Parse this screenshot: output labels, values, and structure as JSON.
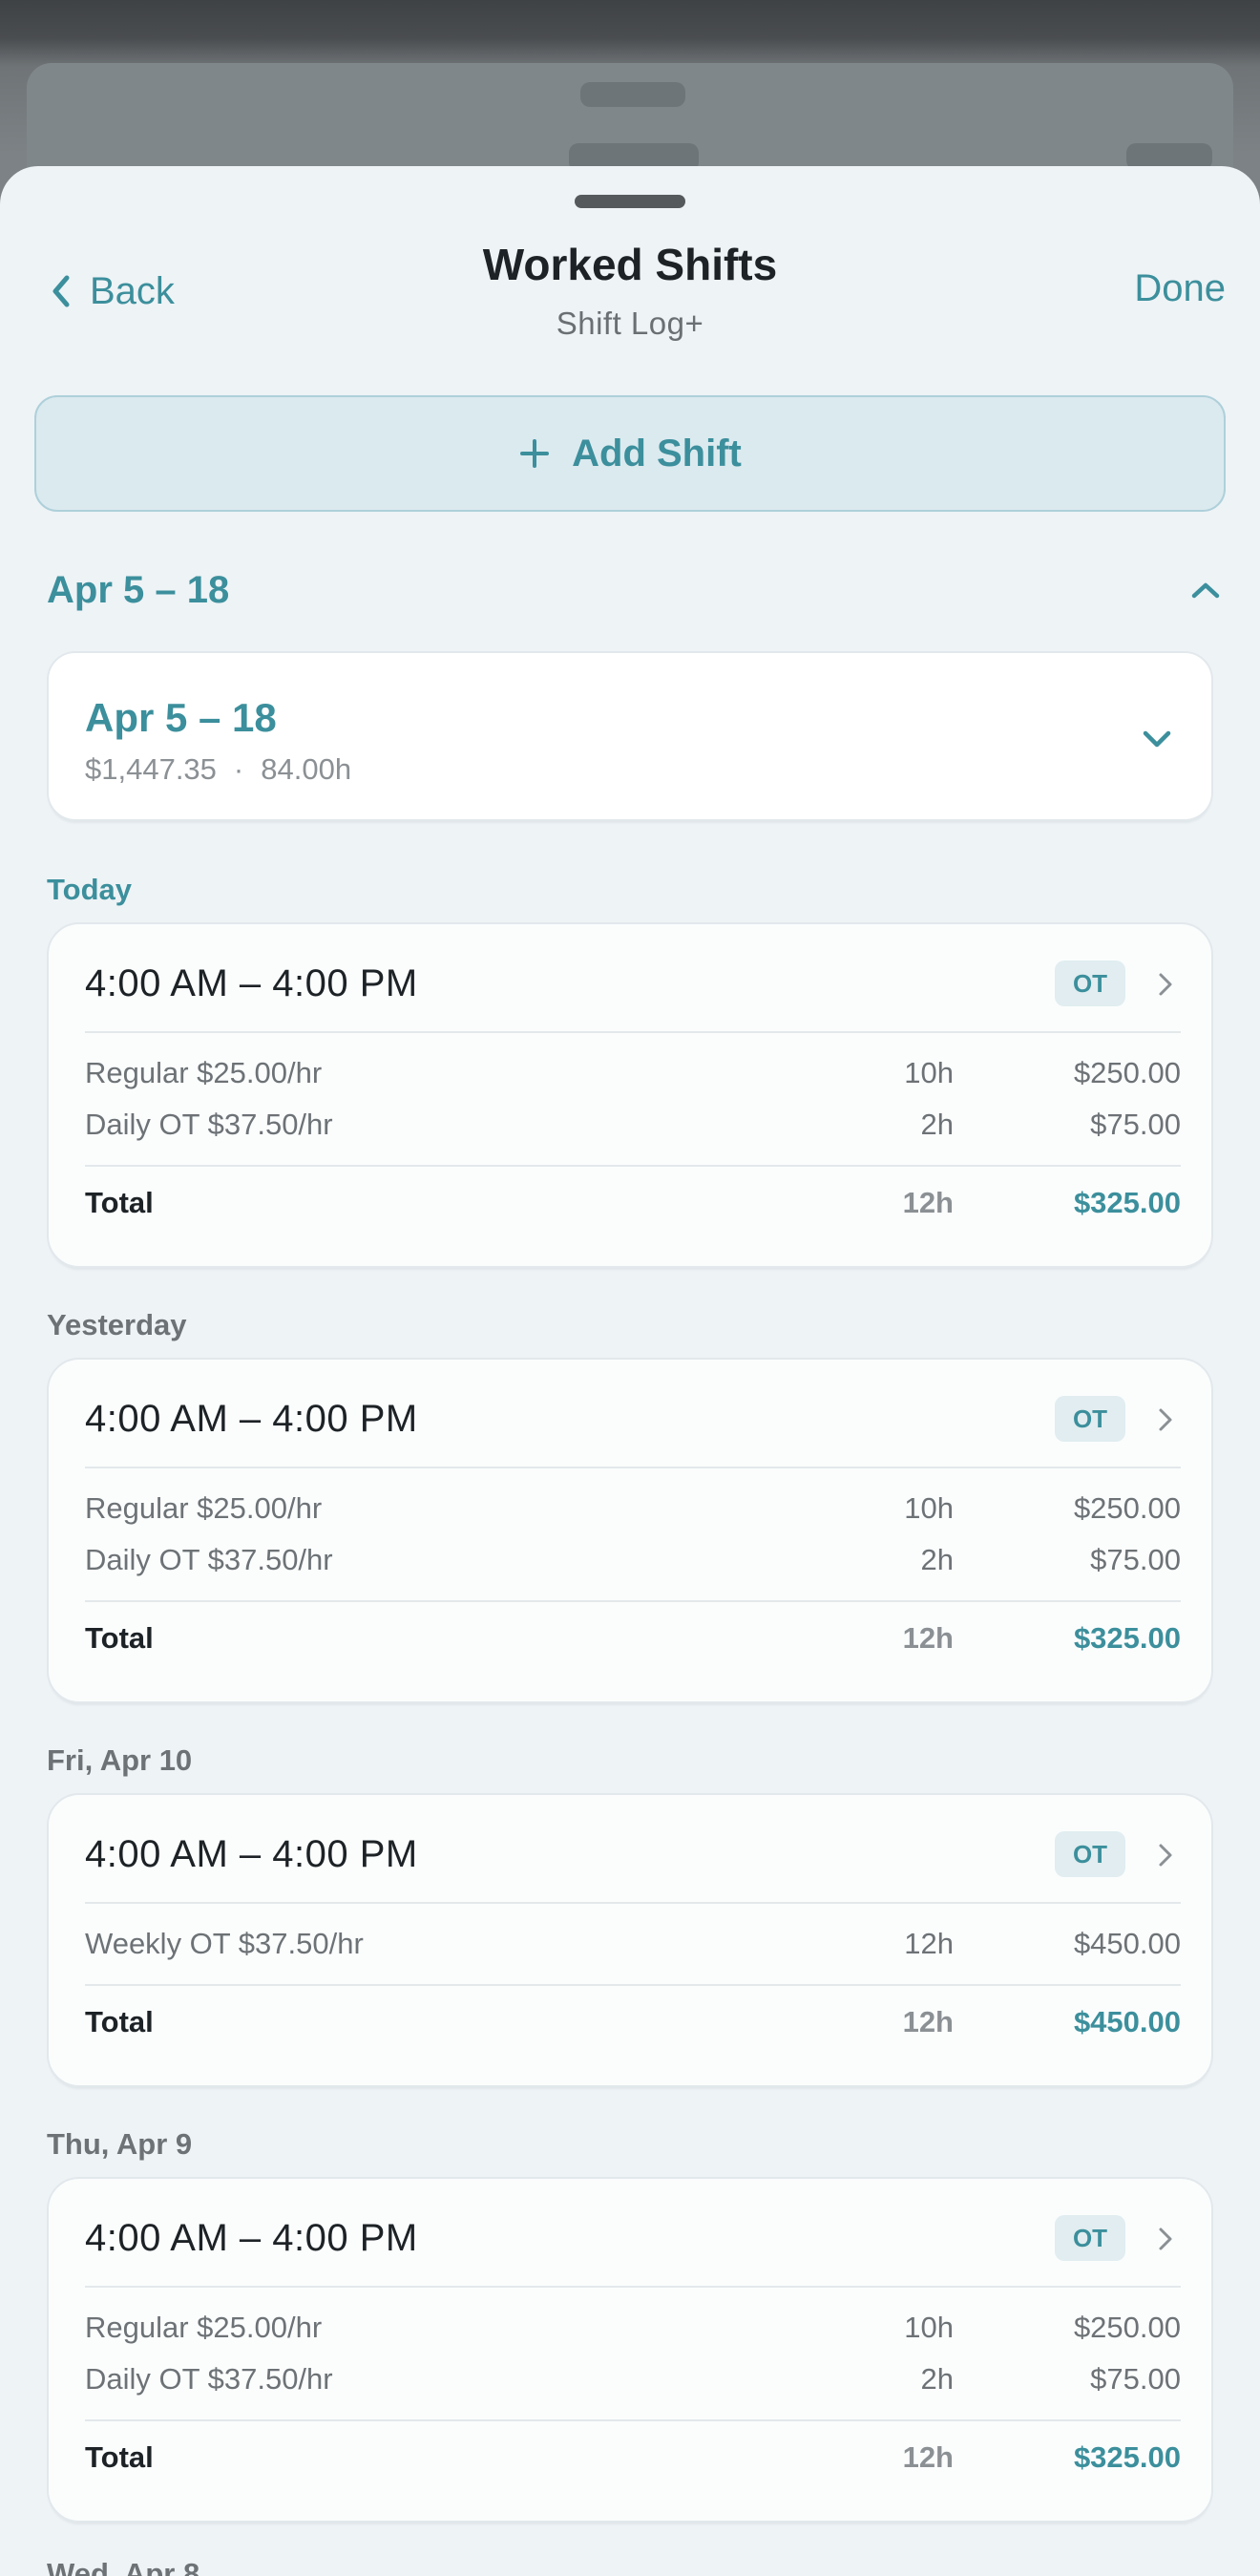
{
  "colors": {
    "accent": "#3c8f9c",
    "sheet_bg": "#eef3f6",
    "card_bg": "#fbfdfd",
    "badge_bg": "#e1edf0"
  },
  "nav": {
    "back_label": "Back",
    "title": "Worked Shifts",
    "subtitle": "Shift Log+",
    "done_label": "Done"
  },
  "add_shift": {
    "label": "Add Shift",
    "icon": "plus-icon"
  },
  "period": {
    "header_label": "Apr 5 – 18",
    "summary": {
      "title": "Apr 5 – 18",
      "earnings": "$1,447.35",
      "separator": "·",
      "hours": "84.00h"
    }
  },
  "days": [
    {
      "label": "Today",
      "shift": {
        "time": "4:00 AM – 4:00 PM",
        "badge": "OT",
        "lines": [
          {
            "desc": "Regular $25.00/hr",
            "hours": "10h",
            "amount": "$250.00"
          },
          {
            "desc": "Daily OT $37.50/hr",
            "hours": "2h",
            "amount": "$75.00"
          }
        ],
        "total": {
          "label": "Total",
          "hours": "12h",
          "amount": "$325.00"
        }
      }
    },
    {
      "label": "Yesterday",
      "shift": {
        "time": "4:00 AM – 4:00 PM",
        "badge": "OT",
        "lines": [
          {
            "desc": "Regular $25.00/hr",
            "hours": "10h",
            "amount": "$250.00"
          },
          {
            "desc": "Daily OT $37.50/hr",
            "hours": "2h",
            "amount": "$75.00"
          }
        ],
        "total": {
          "label": "Total",
          "hours": "12h",
          "amount": "$325.00"
        }
      }
    },
    {
      "label": "Fri, Apr 10",
      "shift": {
        "time": "4:00 AM – 4:00 PM",
        "badge": "OT",
        "lines": [
          {
            "desc": "Weekly OT $37.50/hr",
            "hours": "12h",
            "amount": "$450.00"
          }
        ],
        "total": {
          "label": "Total",
          "hours": "12h",
          "amount": "$450.00"
        }
      }
    },
    {
      "label": "Thu, Apr 9",
      "shift": {
        "time": "4:00 AM – 4:00 PM",
        "badge": "OT",
        "lines": [
          {
            "desc": "Regular $25.00/hr",
            "hours": "10h",
            "amount": "$250.00"
          },
          {
            "desc": "Daily OT $37.50/hr",
            "hours": "2h",
            "amount": "$75.00"
          }
        ],
        "total": {
          "label": "Total",
          "hours": "12h",
          "amount": "$325.00"
        }
      }
    }
  ],
  "next_day_label": "Wed, Apr 8"
}
